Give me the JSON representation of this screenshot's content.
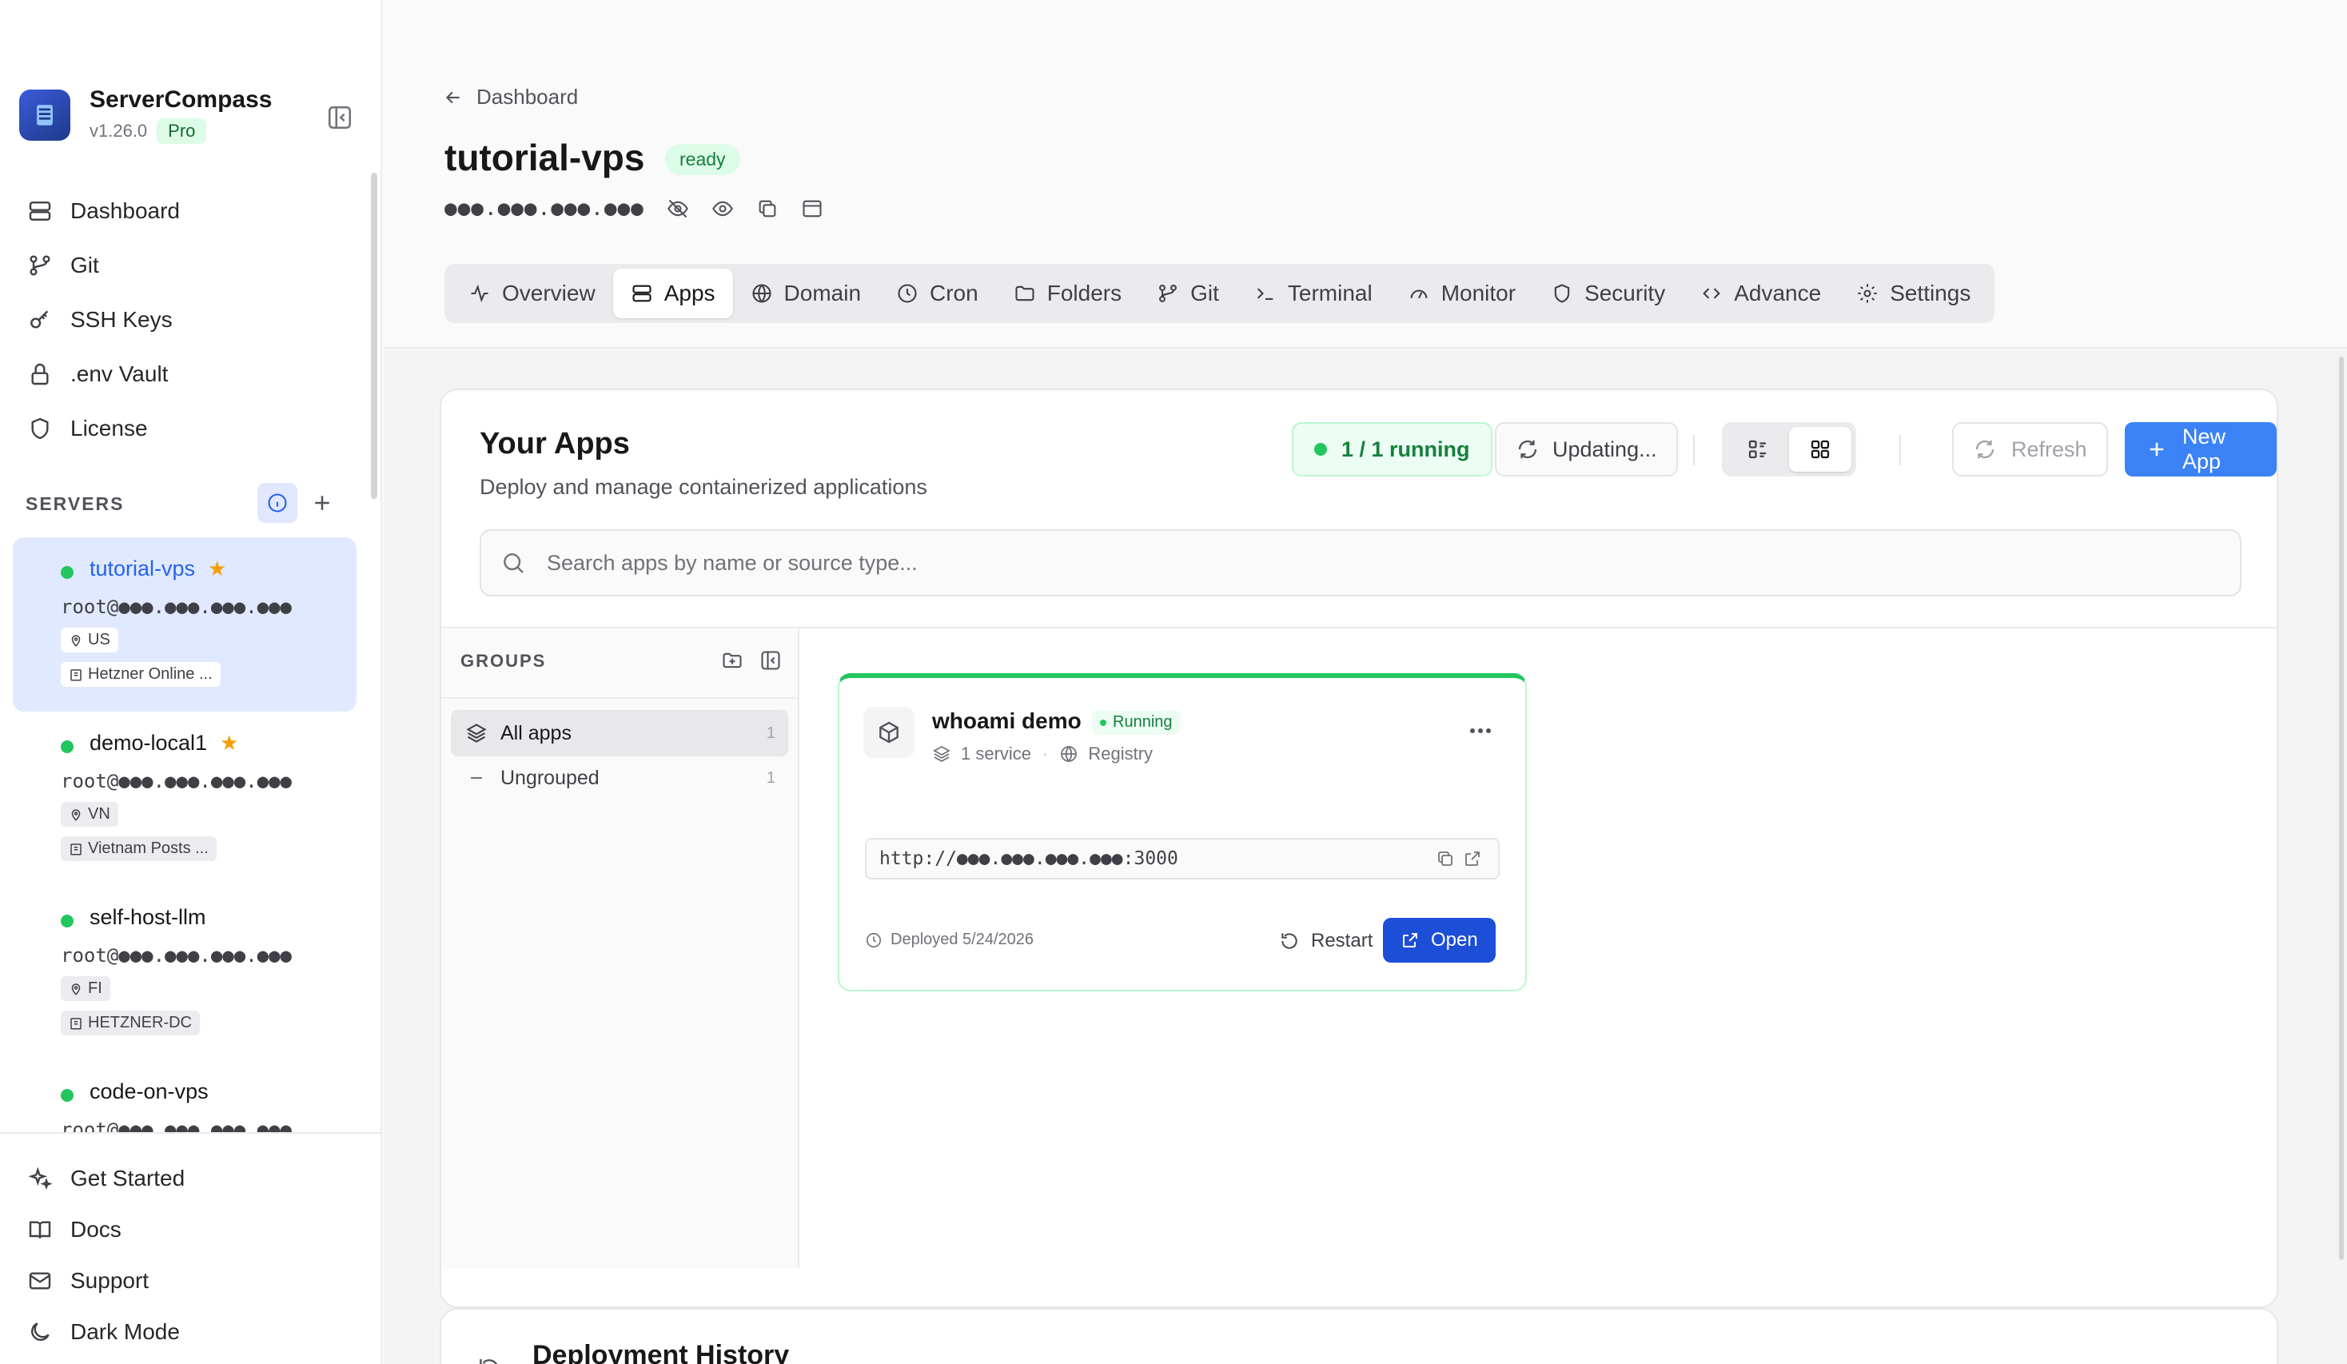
{
  "app": {
    "name": "ServerCompass",
    "version": "v1.26.0",
    "plan": "Pro"
  },
  "nav": [
    {
      "label": "Dashboard",
      "icon": "server-stack-icon"
    },
    {
      "label": "Git",
      "icon": "git-branch-icon"
    },
    {
      "label": "SSH Keys",
      "icon": "key-icon"
    },
    {
      "label": ".env Vault",
      "icon": "lock-icon"
    },
    {
      "label": "License",
      "icon": "shield-icon"
    }
  ],
  "servers": {
    "title": "SERVERS",
    "items": [
      {
        "name": "tutorial-vps",
        "favorite": true,
        "login": "root@●●●.●●●.●●●.●●●",
        "location": "US",
        "provider": "Hetzner Online ...",
        "status_color": "#22c55e",
        "active": true
      },
      {
        "name": "demo-local1",
        "favorite": true,
        "login": "root@●●●.●●●.●●●.●●●",
        "location": "VN",
        "provider": "Vietnam Posts ...",
        "status_color": "#22c55e",
        "active": false
      },
      {
        "name": "self-host-llm",
        "favorite": false,
        "login": "root@●●●.●●●.●●●.●●●",
        "location": "FI",
        "provider": "HETZNER-DC",
        "status_color": "#22c55e",
        "active": false
      },
      {
        "name": "code-on-vps",
        "favorite": false,
        "login": "root@●●●.●●●.●●●.●●●",
        "location": "",
        "provider": "",
        "status_color": "#22c55e",
        "active": false
      }
    ]
  },
  "bottom_nav": [
    {
      "label": "Get Started",
      "icon": "sparkles-icon"
    },
    {
      "label": "Docs",
      "icon": "book-icon"
    },
    {
      "label": "Support",
      "icon": "mail-icon"
    },
    {
      "label": "Dark Mode",
      "icon": "moon-icon"
    }
  ],
  "header": {
    "breadcrumb": "Dashboard",
    "title": "tutorial-vps",
    "status": "ready",
    "ip_masked": "●●●.●●●.●●●.●●●"
  },
  "tabs": [
    {
      "label": "Overview",
      "icon": "activity-icon",
      "active": false
    },
    {
      "label": "Apps",
      "icon": "server-icon",
      "active": true
    },
    {
      "label": "Domain",
      "icon": "globe-icon",
      "active": false
    },
    {
      "label": "Cron",
      "icon": "clock-icon",
      "active": false
    },
    {
      "label": "Folders",
      "icon": "folder-icon",
      "active": false
    },
    {
      "label": "Git",
      "icon": "git-branch-icon",
      "active": false
    },
    {
      "label": "Terminal",
      "icon": "terminal-icon",
      "active": false
    },
    {
      "label": "Monitor",
      "icon": "gauge-icon",
      "active": false
    },
    {
      "label": "Security",
      "icon": "shield-icon",
      "active": false
    },
    {
      "label": "Advance",
      "icon": "code-icon",
      "active": false
    },
    {
      "label": "Settings",
      "icon": "gear-icon",
      "active": false
    }
  ],
  "apps_panel": {
    "title": "Your Apps",
    "subtitle": "Deploy and manage containerized applications",
    "running": "1 / 1 running",
    "updating": "Updating...",
    "refresh": "Refresh",
    "new_app": "New App",
    "search_placeholder": "Search apps by name or source type...",
    "view_mode": "grid"
  },
  "groups": {
    "title": "GROUPS",
    "items": [
      {
        "label": "All apps",
        "count": "1",
        "active": true
      },
      {
        "label": "Ungrouped",
        "count": "1",
        "active": false
      }
    ]
  },
  "app_card": {
    "name": "whoami demo",
    "status": "Running",
    "services": "1 service",
    "source": "Registry",
    "url": "http://●●●.●●●.●●●.●●●:3000",
    "deployed": "Deployed 5/24/2026",
    "restart": "Restart",
    "open": "Open"
  },
  "history": {
    "title": "Deployment History"
  },
  "colors": {
    "accent": "#3b82f6",
    "success": "#22c55e",
    "favorite": "#f59e0b"
  }
}
